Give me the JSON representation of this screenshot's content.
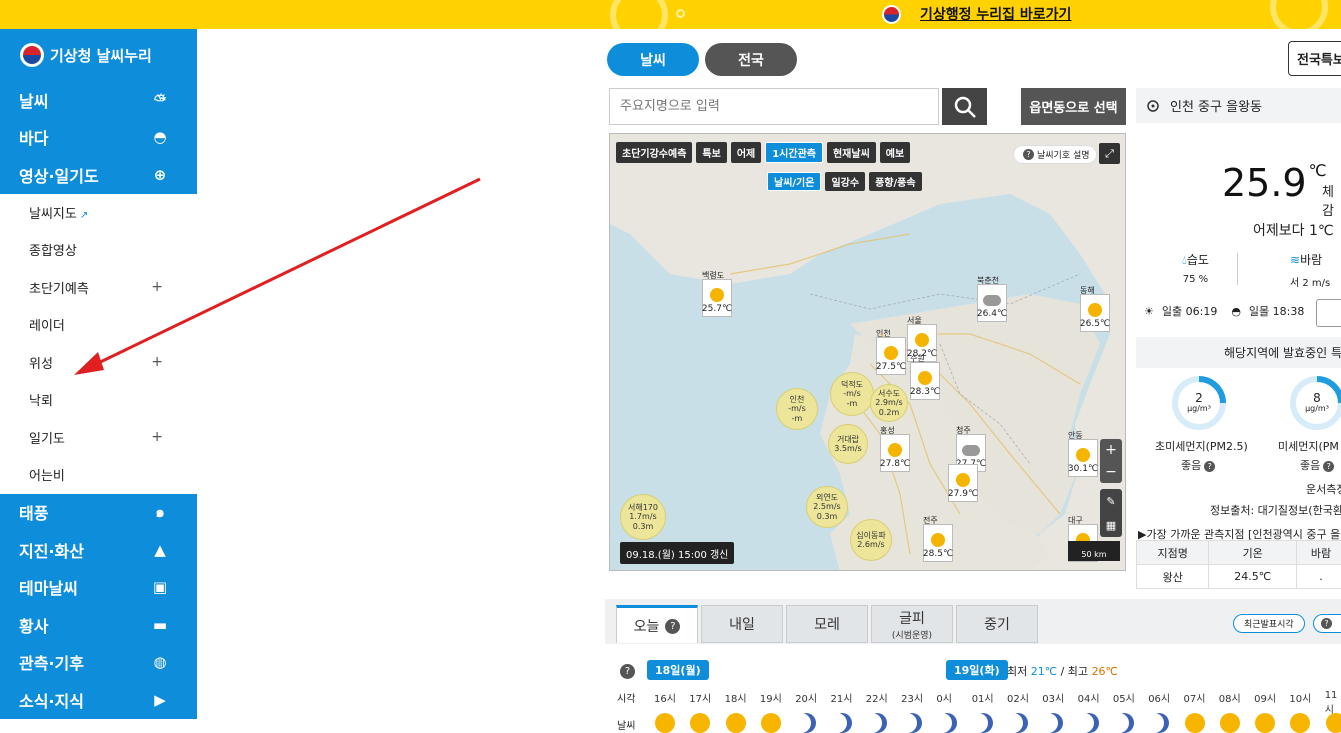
{
  "top_banner": {
    "link": "기상행정 누리집 바로가기"
  },
  "sidebar": {
    "logo": "기상청 날씨누리",
    "menu_top": [
      {
        "label": "날씨",
        "icon": "sun-cloud-icon"
      },
      {
        "label": "바다",
        "icon": "wave-icon"
      },
      {
        "label": "영상·일기도",
        "icon": "satellite-icon"
      }
    ],
    "submenu": [
      {
        "label": "날씨지도",
        "suffix": "↗",
        "plus": ""
      },
      {
        "label": "종합영상",
        "plus": ""
      },
      {
        "label": "초단기예측",
        "plus": "+"
      },
      {
        "label": "레이더",
        "plus": ""
      },
      {
        "label": "위성",
        "plus": "+"
      },
      {
        "label": "낙뢰",
        "plus": ""
      },
      {
        "label": "일기도",
        "plus": "+"
      },
      {
        "label": "어는비",
        "plus": ""
      }
    ],
    "menu_bottom": [
      {
        "label": "태풍",
        "icon": "typhoon-icon"
      },
      {
        "label": "지진·화산",
        "icon": "volcano-icon"
      },
      {
        "label": "테마날씨",
        "icon": "suitcase-icon"
      },
      {
        "label": "황사",
        "icon": "dust-icon"
      },
      {
        "label": "관측·기후",
        "icon": "globe-icon"
      },
      {
        "label": "소식·지식",
        "icon": "video-icon"
      }
    ]
  },
  "main": {
    "tabs": [
      "날씨",
      "전국"
    ],
    "right_button": "전국특보",
    "search_placeholder": "주요지명으로 입력",
    "select_button": "읍면동으로 선택",
    "location": "인천 중구 을왕동"
  },
  "map": {
    "tabs": [
      "초단기강수예측",
      "특보",
      "어제",
      "1시간관측",
      "현재날씨",
      "예보"
    ],
    "active_tab": 3,
    "subtabs": [
      "날씨/기온",
      "일강수",
      "풍향/풍속"
    ],
    "legend": "날씨기호 설명",
    "stamp": "09.18.(월) 15:00 갱신",
    "scale": "50 km",
    "cards": [
      {
        "name": "백령도",
        "temp": "25.7℃",
        "icon": "sun"
      },
      {
        "name": "북춘천",
        "temp": "26.4℃",
        "icon": "cloud"
      },
      {
        "name": "동해",
        "temp": "26.5℃",
        "icon": "sun"
      },
      {
        "name": "인천",
        "temp": "27.5℃",
        "icon": "sun"
      },
      {
        "name": "서울",
        "temp": "28.2℃",
        "icon": "sun"
      },
      {
        "name": "수원",
        "temp": "28.3℃",
        "icon": "sun"
      },
      {
        "name": "홍성",
        "temp": "27.8℃",
        "icon": "sun"
      },
      {
        "name": "청주",
        "temp": "27.7℃",
        "icon": "cloud"
      },
      {
        "name": "",
        "temp": "27.9℃",
        "icon": "sun"
      },
      {
        "name": "안동",
        "temp": "30.1℃",
        "icon": "sun"
      },
      {
        "name": "전주",
        "temp": "28.5℃",
        "icon": "sun"
      },
      {
        "name": "대구",
        "temp": "31.3℃",
        "icon": "sun"
      }
    ],
    "bubbles": [
      {
        "name": "인천",
        "l1": "-m/s",
        "l2": "-m"
      },
      {
        "name": "덕적도",
        "l1": "-m/s",
        "l2": "-m"
      },
      {
        "name": "서수도",
        "l1": "2.9m/s",
        "l2": "0.2m"
      },
      {
        "name": "거대랍",
        "l1": "3.5m/s",
        "l2": ""
      },
      {
        "name": "외연도",
        "l1": "2.5m/s",
        "l2": "0.3m"
      },
      {
        "name": "서해170",
        "l1": "1.7m/s",
        "l2": "0.3m"
      },
      {
        "name": "십이동파",
        "l1": "2.6m/s",
        "l2": ""
      }
    ]
  },
  "current": {
    "temp": "25.9",
    "unit": "℃",
    "feel": "체감",
    "compare": "어제보다 1℃",
    "humidity_label": "습도",
    "humidity": "75 %",
    "wind_label": "바람",
    "wind": "서 2 m/s",
    "sunrise": "일출 06:19",
    "sunset": "일몰 18:38",
    "alert": "해당지역에 발효중인 특보",
    "pm25_value": "2",
    "pm25_unit": "μg/m³",
    "pm25_label": "초미세먼지(PM2.5)",
    "pm25_status": "좋음",
    "pm10_value": "8",
    "pm10_unit": "μg/m³",
    "pm10_label": "미세먼지(PM",
    "pm10_status": "좋음",
    "station": "운서측정",
    "source": "정보출처: 대기질정보(한국환경",
    "obs_title": "▶가장 가까운 관측지점 [인천광역시 중구 을왕",
    "obs_headers": [
      "지점명",
      "기온",
      "바람"
    ],
    "obs_row": [
      "왕산",
      "24.5℃",
      "."
    ]
  },
  "forecast": {
    "tabs": [
      {
        "label": "오늘",
        "sub": ""
      },
      {
        "label": "내일",
        "sub": ""
      },
      {
        "label": "모레",
        "sub": ""
      },
      {
        "label": "글피",
        "sub": "(시범운영)"
      },
      {
        "label": "중기",
        "sub": ""
      }
    ],
    "recent_button": "최근발표시각",
    "day1": "18일(월)",
    "day2": "19일(화)",
    "min_max_prefix": "최저",
    "min": "21℃",
    "max_prefix": "/ 최고",
    "max": "26℃",
    "row_time": "시각",
    "row_weather": "날씨",
    "hours": [
      "16시",
      "17시",
      "18시",
      "19시",
      "20시",
      "21시",
      "22시",
      "23시",
      "0시",
      "01시",
      "02시",
      "03시",
      "04시",
      "05시",
      "06시",
      "07시",
      "08시",
      "09시",
      "10시",
      "11시"
    ],
    "icons": [
      "sun",
      "sun",
      "sun",
      "sun",
      "moon",
      "moon",
      "moon",
      "moon",
      "moon",
      "moon",
      "moon",
      "moon",
      "moon",
      "moon",
      "moon",
      "sun",
      "sun",
      "sun",
      "sun",
      "sun"
    ]
  }
}
